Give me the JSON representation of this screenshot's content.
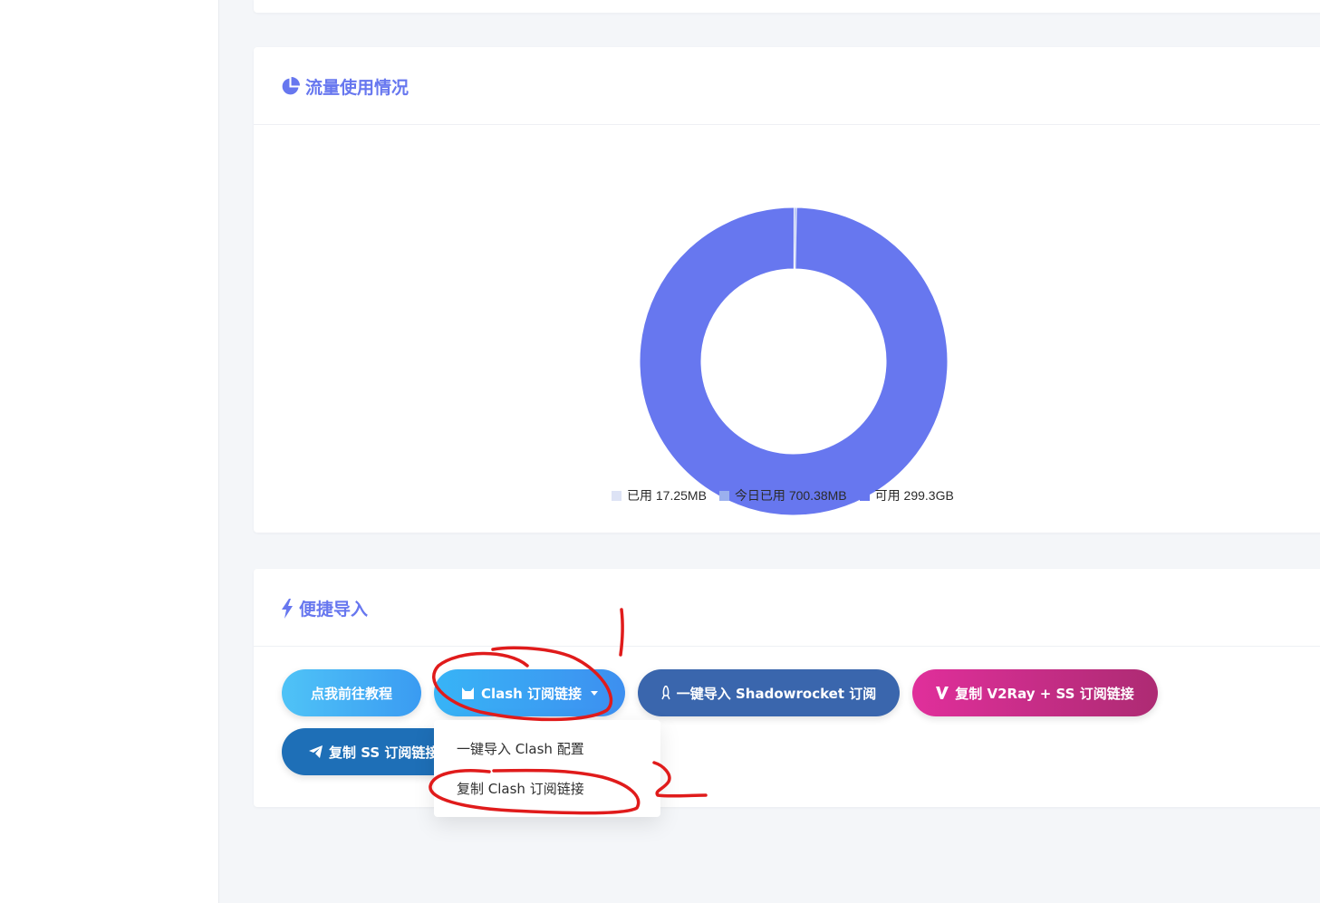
{
  "traffic_card": {
    "title": "流量使用情况",
    "icon": "pie-chart-icon"
  },
  "chart_data": {
    "type": "pie",
    "style": "donut",
    "series": [
      {
        "name": "已用",
        "label": "已用 17.25MB",
        "value_mb": 17.25,
        "color": "#dde3f5"
      },
      {
        "name": "今日已用",
        "label": "今日已用 700.38MB",
        "value_mb": 700.38,
        "color": "#9bb0ee"
      },
      {
        "name": "可用",
        "label": "可用 299.3GB",
        "value_mb": 306483.2,
        "color": "#6777ef"
      }
    ],
    "legend_position": "bottom"
  },
  "import_card": {
    "title": "便捷导入",
    "icon": "bolt-icon",
    "buttons": {
      "tutorial": "点我前往教程",
      "clash": "Clash 订阅链接",
      "shadowrocket": "一键导入 Shadowrocket 订阅",
      "v2ray": "复制 V2Ray + SS 订阅链接",
      "ss": "复制 SS 订阅链接"
    },
    "clash_dropdown": {
      "items": [
        "一键导入 Clash 配置",
        "复制 Clash 订阅链接"
      ]
    }
  },
  "colors": {
    "accent": "#6777ef",
    "annotation": "#e01b1b"
  }
}
